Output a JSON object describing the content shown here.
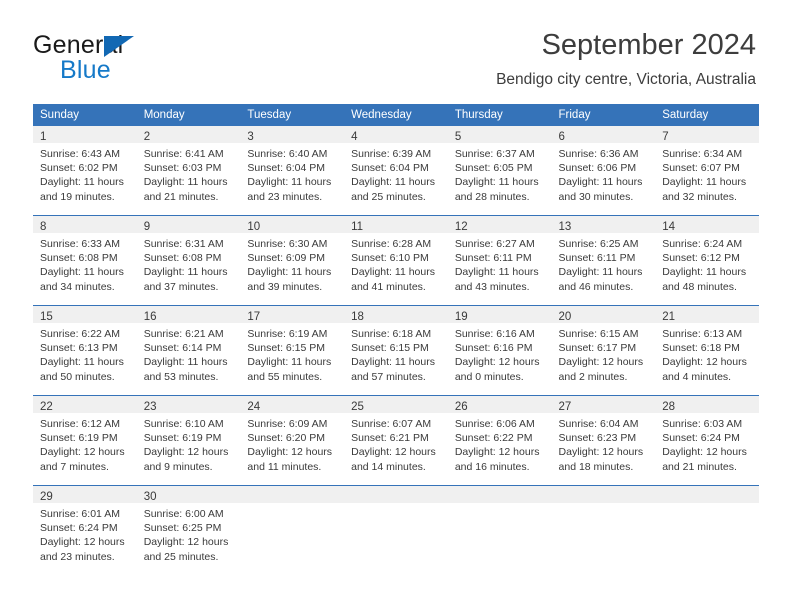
{
  "brand": {
    "name_part1": "General",
    "name_part2": "Blue",
    "triangle_color": "#1268b3",
    "blue_color": "#1579c8"
  },
  "header": {
    "title": "September 2024",
    "subtitle": "Bendigo city centre, Victoria, Australia"
  },
  "theme": {
    "header_row_bg": "#3573b9",
    "daynum_band_bg": "#f0f0f0",
    "row_divider": "#3573b9",
    "text": "#3a3a3a"
  },
  "weekday_headers": [
    "Sunday",
    "Monday",
    "Tuesday",
    "Wednesday",
    "Thursday",
    "Friday",
    "Saturday"
  ],
  "weeks": [
    [
      {
        "day": "1",
        "sunrise": "Sunrise: 6:43 AM",
        "sunset": "Sunset: 6:02 PM",
        "daylight1": "Daylight: 11 hours",
        "daylight2": "and 19 minutes."
      },
      {
        "day": "2",
        "sunrise": "Sunrise: 6:41 AM",
        "sunset": "Sunset: 6:03 PM",
        "daylight1": "Daylight: 11 hours",
        "daylight2": "and 21 minutes."
      },
      {
        "day": "3",
        "sunrise": "Sunrise: 6:40 AM",
        "sunset": "Sunset: 6:04 PM",
        "daylight1": "Daylight: 11 hours",
        "daylight2": "and 23 minutes."
      },
      {
        "day": "4",
        "sunrise": "Sunrise: 6:39 AM",
        "sunset": "Sunset: 6:04 PM",
        "daylight1": "Daylight: 11 hours",
        "daylight2": "and 25 minutes."
      },
      {
        "day": "5",
        "sunrise": "Sunrise: 6:37 AM",
        "sunset": "Sunset: 6:05 PM",
        "daylight1": "Daylight: 11 hours",
        "daylight2": "and 28 minutes."
      },
      {
        "day": "6",
        "sunrise": "Sunrise: 6:36 AM",
        "sunset": "Sunset: 6:06 PM",
        "daylight1": "Daylight: 11 hours",
        "daylight2": "and 30 minutes."
      },
      {
        "day": "7",
        "sunrise": "Sunrise: 6:34 AM",
        "sunset": "Sunset: 6:07 PM",
        "daylight1": "Daylight: 11 hours",
        "daylight2": "and 32 minutes."
      }
    ],
    [
      {
        "day": "8",
        "sunrise": "Sunrise: 6:33 AM",
        "sunset": "Sunset: 6:08 PM",
        "daylight1": "Daylight: 11 hours",
        "daylight2": "and 34 minutes."
      },
      {
        "day": "9",
        "sunrise": "Sunrise: 6:31 AM",
        "sunset": "Sunset: 6:08 PM",
        "daylight1": "Daylight: 11 hours",
        "daylight2": "and 37 minutes."
      },
      {
        "day": "10",
        "sunrise": "Sunrise: 6:30 AM",
        "sunset": "Sunset: 6:09 PM",
        "daylight1": "Daylight: 11 hours",
        "daylight2": "and 39 minutes."
      },
      {
        "day": "11",
        "sunrise": "Sunrise: 6:28 AM",
        "sunset": "Sunset: 6:10 PM",
        "daylight1": "Daylight: 11 hours",
        "daylight2": "and 41 minutes."
      },
      {
        "day": "12",
        "sunrise": "Sunrise: 6:27 AM",
        "sunset": "Sunset: 6:11 PM",
        "daylight1": "Daylight: 11 hours",
        "daylight2": "and 43 minutes."
      },
      {
        "day": "13",
        "sunrise": "Sunrise: 6:25 AM",
        "sunset": "Sunset: 6:11 PM",
        "daylight1": "Daylight: 11 hours",
        "daylight2": "and 46 minutes."
      },
      {
        "day": "14",
        "sunrise": "Sunrise: 6:24 AM",
        "sunset": "Sunset: 6:12 PM",
        "daylight1": "Daylight: 11 hours",
        "daylight2": "and 48 minutes."
      }
    ],
    [
      {
        "day": "15",
        "sunrise": "Sunrise: 6:22 AM",
        "sunset": "Sunset: 6:13 PM",
        "daylight1": "Daylight: 11 hours",
        "daylight2": "and 50 minutes."
      },
      {
        "day": "16",
        "sunrise": "Sunrise: 6:21 AM",
        "sunset": "Sunset: 6:14 PM",
        "daylight1": "Daylight: 11 hours",
        "daylight2": "and 53 minutes."
      },
      {
        "day": "17",
        "sunrise": "Sunrise: 6:19 AM",
        "sunset": "Sunset: 6:15 PM",
        "daylight1": "Daylight: 11 hours",
        "daylight2": "and 55 minutes."
      },
      {
        "day": "18",
        "sunrise": "Sunrise: 6:18 AM",
        "sunset": "Sunset: 6:15 PM",
        "daylight1": "Daylight: 11 hours",
        "daylight2": "and 57 minutes."
      },
      {
        "day": "19",
        "sunrise": "Sunrise: 6:16 AM",
        "sunset": "Sunset: 6:16 PM",
        "daylight1": "Daylight: 12 hours",
        "daylight2": "and 0 minutes."
      },
      {
        "day": "20",
        "sunrise": "Sunrise: 6:15 AM",
        "sunset": "Sunset: 6:17 PM",
        "daylight1": "Daylight: 12 hours",
        "daylight2": "and 2 minutes."
      },
      {
        "day": "21",
        "sunrise": "Sunrise: 6:13 AM",
        "sunset": "Sunset: 6:18 PM",
        "daylight1": "Daylight: 12 hours",
        "daylight2": "and 4 minutes."
      }
    ],
    [
      {
        "day": "22",
        "sunrise": "Sunrise: 6:12 AM",
        "sunset": "Sunset: 6:19 PM",
        "daylight1": "Daylight: 12 hours",
        "daylight2": "and 7 minutes."
      },
      {
        "day": "23",
        "sunrise": "Sunrise: 6:10 AM",
        "sunset": "Sunset: 6:19 PM",
        "daylight1": "Daylight: 12 hours",
        "daylight2": "and 9 minutes."
      },
      {
        "day": "24",
        "sunrise": "Sunrise: 6:09 AM",
        "sunset": "Sunset: 6:20 PM",
        "daylight1": "Daylight: 12 hours",
        "daylight2": "and 11 minutes."
      },
      {
        "day": "25",
        "sunrise": "Sunrise: 6:07 AM",
        "sunset": "Sunset: 6:21 PM",
        "daylight1": "Daylight: 12 hours",
        "daylight2": "and 14 minutes."
      },
      {
        "day": "26",
        "sunrise": "Sunrise: 6:06 AM",
        "sunset": "Sunset: 6:22 PM",
        "daylight1": "Daylight: 12 hours",
        "daylight2": "and 16 minutes."
      },
      {
        "day": "27",
        "sunrise": "Sunrise: 6:04 AM",
        "sunset": "Sunset: 6:23 PM",
        "daylight1": "Daylight: 12 hours",
        "daylight2": "and 18 minutes."
      },
      {
        "day": "28",
        "sunrise": "Sunrise: 6:03 AM",
        "sunset": "Sunset: 6:24 PM",
        "daylight1": "Daylight: 12 hours",
        "daylight2": "and 21 minutes."
      }
    ],
    [
      {
        "day": "29",
        "sunrise": "Sunrise: 6:01 AM",
        "sunset": "Sunset: 6:24 PM",
        "daylight1": "Daylight: 12 hours",
        "daylight2": "and 23 minutes."
      },
      {
        "day": "30",
        "sunrise": "Sunrise: 6:00 AM",
        "sunset": "Sunset: 6:25 PM",
        "daylight1": "Daylight: 12 hours",
        "daylight2": "and 25 minutes."
      },
      {
        "day": "",
        "sunrise": "",
        "sunset": "",
        "daylight1": "",
        "daylight2": ""
      },
      {
        "day": "",
        "sunrise": "",
        "sunset": "",
        "daylight1": "",
        "daylight2": ""
      },
      {
        "day": "",
        "sunrise": "",
        "sunset": "",
        "daylight1": "",
        "daylight2": ""
      },
      {
        "day": "",
        "sunrise": "",
        "sunset": "",
        "daylight1": "",
        "daylight2": ""
      },
      {
        "day": "",
        "sunrise": "",
        "sunset": "",
        "daylight1": "",
        "daylight2": ""
      }
    ]
  ]
}
